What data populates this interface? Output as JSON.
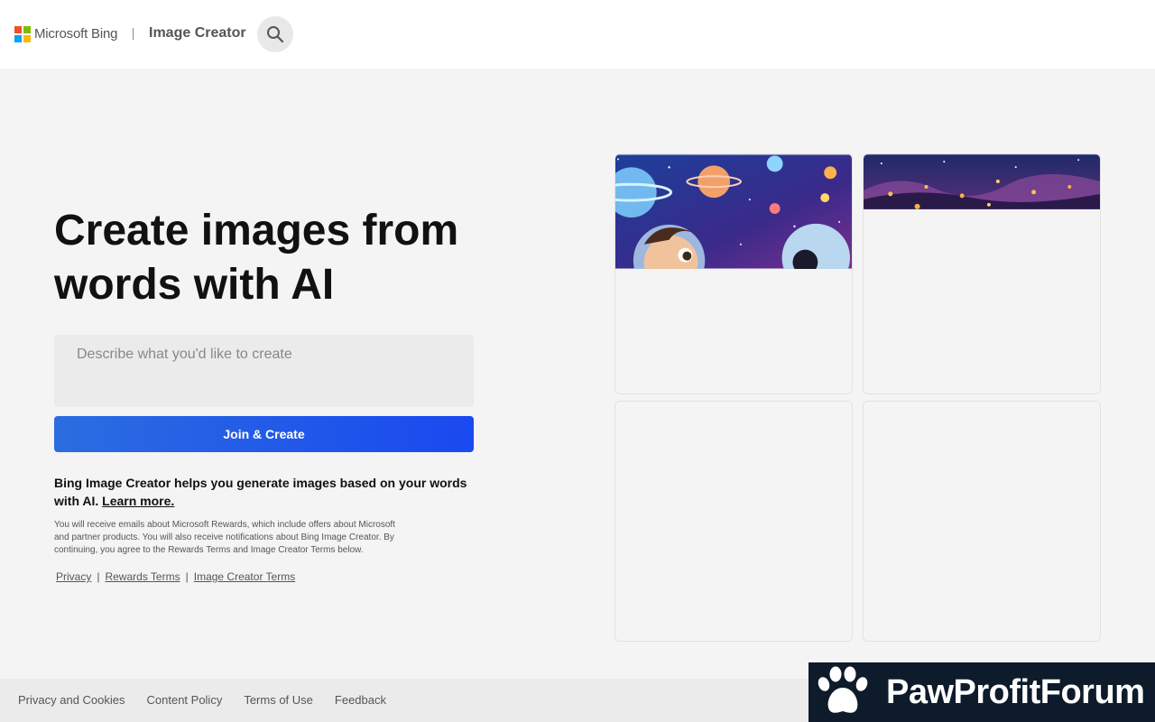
{
  "header": {
    "brand": "Microsoft Bing",
    "app_title": "Image Creator",
    "search_icon": "search-icon",
    "logo_colors": [
      "#f25022",
      "#7fba00",
      "#00a4ef",
      "#ffb900"
    ]
  },
  "hero": {
    "title": "Create images from words with AI",
    "prompt_placeholder": "Describe what you'd like to create",
    "prompt_value": "",
    "join_button": "Join & Create",
    "accent_color": "#1a49f0"
  },
  "info": {
    "description": "Bing Image Creator helps you generate images based on your words with AI.",
    "learn_more": "Learn more.",
    "fineprint": "You will receive emails about Microsoft Rewards, which include offers about Microsoft and partner products. You will also receive notifications about Bing Image Creator. By continuing, you agree to the Rewards Terms and Image Creator Terms below.",
    "links": [
      "Privacy",
      "Rewards Terms",
      "Image Creator Terms"
    ]
  },
  "gallery": {
    "cards": [
      {
        "subject": "cartoon boy astronaut among planets"
      },
      {
        "subject": "night sky with lanterns over forest"
      },
      {
        "subject": ""
      },
      {
        "subject": ""
      }
    ]
  },
  "footer": {
    "links": [
      "Privacy and Cookies",
      "Content Policy",
      "Terms of Use",
      "Feedback"
    ]
  },
  "watermark": {
    "text": "PawProfitForum",
    "icon": "paw-icon"
  }
}
